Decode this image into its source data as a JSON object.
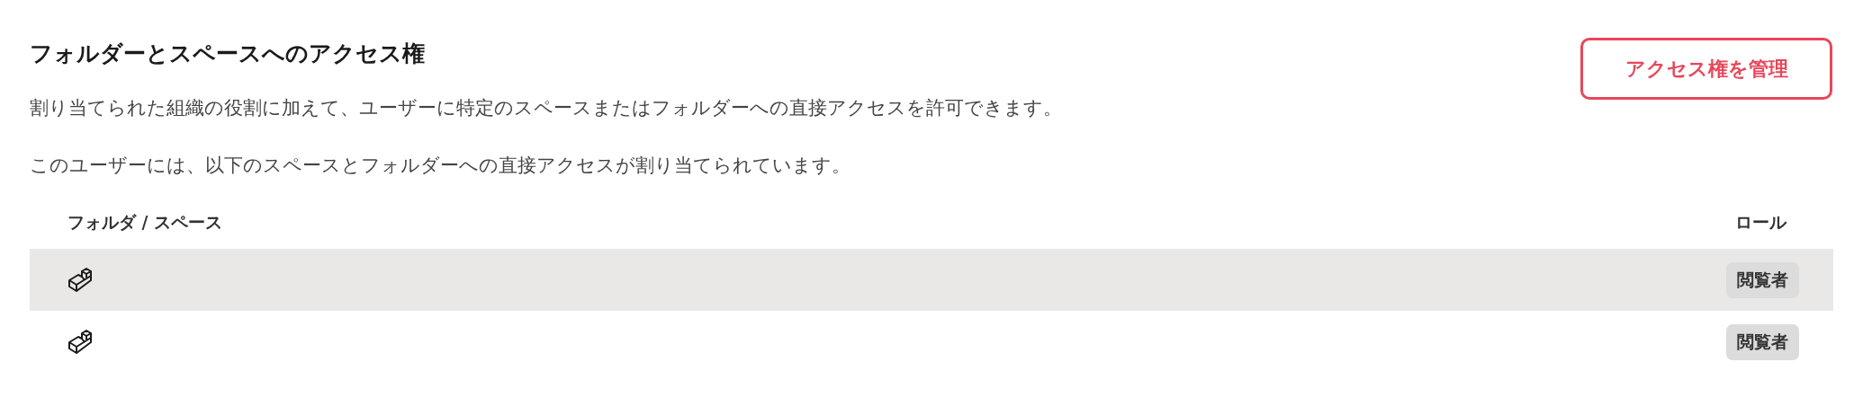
{
  "section": {
    "title": "フォルダーとスペースへのアクセス権",
    "description": "割り当てられた組織の役割に加えて、ユーザーに特定のスペースまたはフォルダーへの直接アクセスを許可できます。",
    "note": "このユーザーには、以下のスペースとフォルダーへの直接アクセスが割り当てられています。"
  },
  "manage_button": {
    "label": "アクセス権を管理"
  },
  "table": {
    "columns": [
      "フォルダ / スペース",
      "ロール"
    ],
    "rows": [
      {
        "highlighted": true,
        "role": "閲覧者"
      },
      {
        "highlighted": false,
        "role": "閲覧者"
      }
    ]
  }
}
